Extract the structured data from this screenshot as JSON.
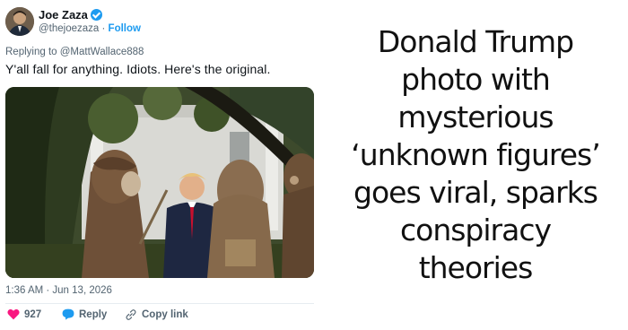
{
  "tweet": {
    "author_name": "Joe Zaza",
    "author_handle": "@thejoezaza",
    "separator": " · ",
    "follow_label": "Follow",
    "replying_prefix": "Replying to ",
    "replying_to": "@MattWallace888",
    "text": "Y'all fall for anything. Idiots. Here's the original.",
    "timestamp": "1:36 AM · Jun 13, 2026",
    "likes_count": "927",
    "reply_label": "Reply",
    "copy_link_label": "Copy link"
  },
  "headline": {
    "lines": [
      "Donald Trump",
      "photo with",
      "mysterious",
      "‘unknown figures’",
      "goes viral, sparks",
      "conspiracy",
      "theories"
    ]
  },
  "colors": {
    "like": "#f91880",
    "reply": "#1d9bf0",
    "verified": "#1d9bf0",
    "link": "#1d9bf0"
  },
  "icons": [
    "verified-badge-icon",
    "heart-icon",
    "reply-bubble-icon",
    "link-icon"
  ]
}
